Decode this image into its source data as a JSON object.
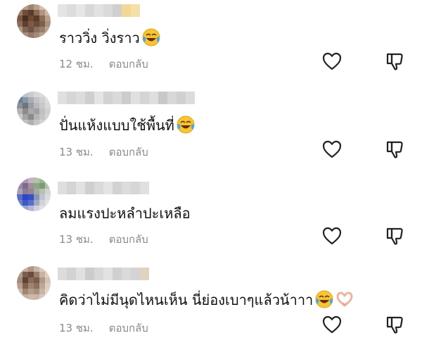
{
  "comments": [
    {
      "text": "ราววิ่ง วิ่งราว",
      "time": "12 ชม.",
      "reply": "ตอบกลับ",
      "emoji": "face-with-tears-of-joy-icon"
    },
    {
      "text": "ปั่นแห้งแบบใช้พื้นที่",
      "time": "13 ชม.",
      "reply": "ตอบกลับ",
      "emoji": "face-with-tears-of-joy-icon"
    },
    {
      "text": "ลมแรงปะหลำปะเหลือ",
      "time": "13 ชม.",
      "reply": "ตอบกลับ"
    },
    {
      "text": "คิดว่าไม่มีนุดไหนเห็น นี่ย่องเบาๆแล้วน้าาา",
      "time": "13 ชม.",
      "reply": "ตอบกลับ",
      "emoji": "face-with-tears-of-joy-icon",
      "emoji2": "heart-hands-icon"
    }
  ],
  "icons": {
    "like": "heart-outline-icon",
    "dislike": "thumbs-down-icon"
  },
  "colors": {
    "meta": "#8a8a8a",
    "text": "#111111",
    "icon": "#222222"
  }
}
